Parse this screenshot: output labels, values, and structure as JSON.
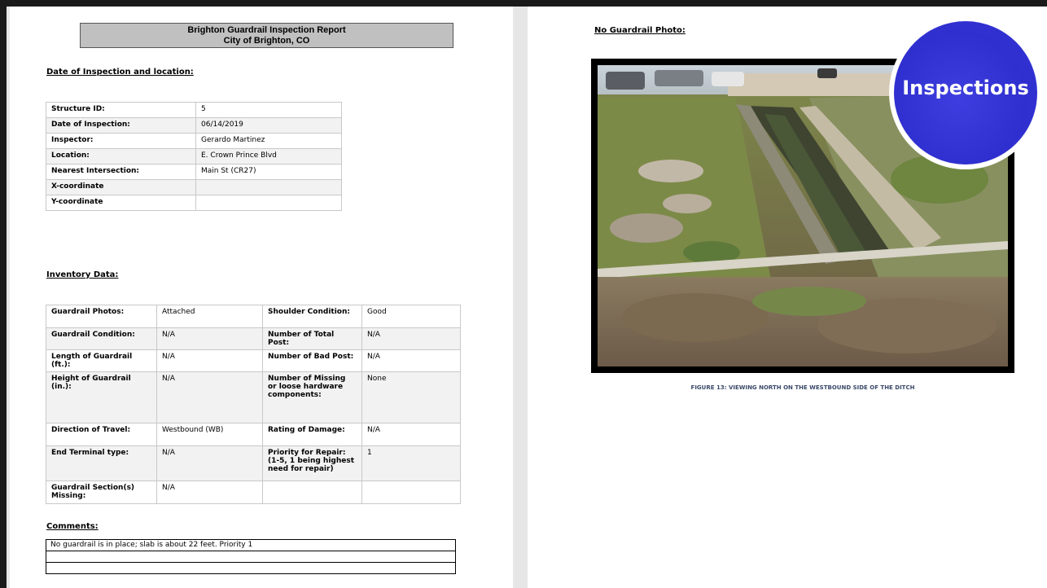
{
  "report": {
    "title_line1": "Brighton Guardrail Inspection Report",
    "title_line2": "City of Brighton, CO"
  },
  "headings": {
    "date_location": "Date of Inspection and location:",
    "inventory": "Inventory Data:",
    "comments": "Comments:",
    "photo": "No Guardrail Photo:"
  },
  "structure": [
    {
      "label": "Structure ID:",
      "value": "5"
    },
    {
      "label": "Date of Inspection:",
      "value": "06/14/2019"
    },
    {
      "label": "Inspector:",
      "value": "Gerardo Martinez"
    },
    {
      "label": "Location:",
      "value": "E. Crown Prince Blvd"
    },
    {
      "label": "Nearest Intersection:",
      "value": "Main St (CR27)"
    },
    {
      "label": "X-coordinate",
      "value": ""
    },
    {
      "label": "Y-coordinate",
      "value": ""
    }
  ],
  "inventory": [
    {
      "l1": "Guardrail Photos:",
      "v1": "Attached",
      "l2": "Shoulder Condition:",
      "v2": "Good"
    },
    {
      "l1": "Guardrail Condition:",
      "v1": "N/A",
      "l2": "Number of Total Post:",
      "v2": "N/A"
    },
    {
      "l1": "Length of Guardrail (ft.):",
      "v1": "N/A",
      "l2": "Number of Bad Post:",
      "v2": "N/A"
    },
    {
      "l1": "Height of Guardrail (in.):",
      "v1": "N/A",
      "l2": "Number of Missing or loose hardware components:",
      "v2": "None"
    },
    {
      "l1": "Direction of Travel:",
      "v1": "Westbound (WB)",
      "l2": "Rating of Damage:",
      "v2": "N/A"
    },
    {
      "l1": "End Terminal type:",
      "v1": "N/A",
      "l2": "Priority for Repair: (1-5, 1 being highest need for repair)",
      "v2": "1"
    },
    {
      "l1": "Guardrail Section(s) Missing:",
      "v1": "N/A",
      "l2": "",
      "v2": ""
    }
  ],
  "comments": [
    "No guardrail is in place; slab is about 22 feet. Priority 1",
    "",
    ""
  ],
  "figure": {
    "caption": "FIGURE 13: VIEWING NORTH ON THE WESTBOUND SIDE OF THE DITCH"
  },
  "badge": {
    "label": "Inspections"
  },
  "colors": {
    "badge_blue": "#3535d8",
    "title_box_gray": "#c0c0c0",
    "caption_blue": "#3a4a6a"
  }
}
